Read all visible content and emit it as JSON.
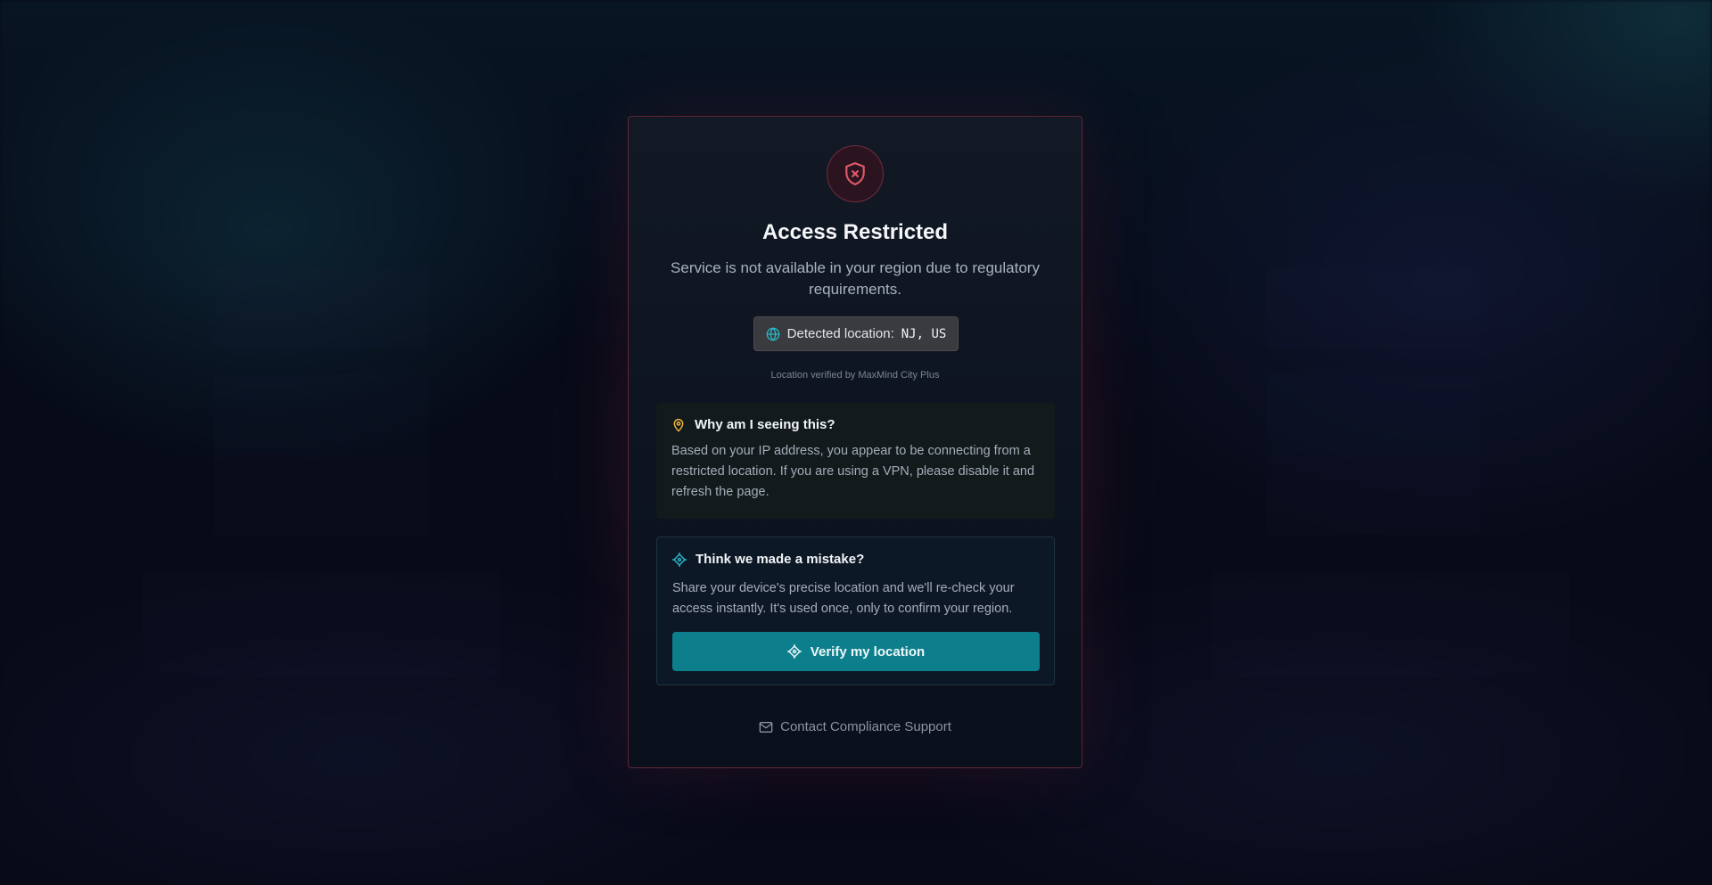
{
  "colors": {
    "accent": "#0d7f8c",
    "danger": "#e05a6a",
    "warning_icon": "#f2b441",
    "teal_icon": "#28b8c8"
  },
  "header": {
    "icon": "shield-x-icon",
    "title": "Access Restricted",
    "subtitle": "Service is not available in your region due to regulatory requirements."
  },
  "location": {
    "icon": "globe-icon",
    "label": "Detected location:",
    "value": "NJ, US",
    "verified_note": "Location verified by MaxMind City Plus"
  },
  "why": {
    "icon": "map-pin-icon",
    "heading": "Why am I seeing this?",
    "text": "Based on your IP address, you appear to be connecting from a restricted location. If you are using a VPN, please disable it and refresh the page."
  },
  "mistake": {
    "icon": "locate-icon",
    "heading": "Think we made a mistake?",
    "text": "Share your device's precise location and we'll re-check your access instantly. It's used once, only to confirm your region.",
    "button_label": "Verify my location"
  },
  "footer": {
    "icon": "mail-icon",
    "contact_label": "Contact Compliance Support"
  }
}
